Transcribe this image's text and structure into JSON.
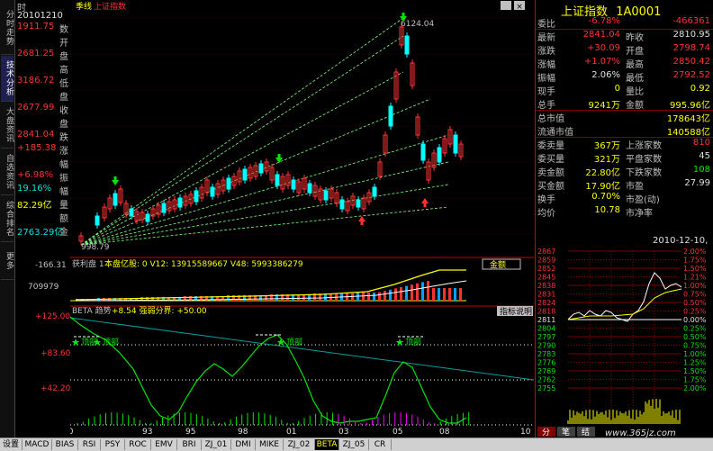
{
  "window": {
    "period_label": "季线",
    "index_label": "上证指数",
    "close_glyph": "×"
  },
  "vtabs": [
    {
      "label": "分时走势",
      "active": false
    },
    {
      "label": "技术分析",
      "active": true
    },
    {
      "label": "大盘资讯",
      "active": false
    },
    {
      "label": "自选资讯",
      "active": false
    },
    {
      "label": "综合排名",
      "active": false
    },
    {
      "label": "更多",
      "active": false
    }
  ],
  "info": {
    "header_time": "时",
    "date": "20101210",
    "rows": [
      {
        "label": "数",
        "value": "1911.75",
        "color": "red"
      },
      {
        "label": "开",
        "value": ""
      },
      {
        "label": "盘",
        "value": "2681.25",
        "color": "red"
      },
      {
        "label": "高",
        "value": ""
      },
      {
        "label": "低",
        "value": "3186.72",
        "color": "red"
      },
      {
        "label": "盘",
        "value": ""
      },
      {
        "label": "收",
        "value": "2677.99",
        "color": "red"
      },
      {
        "label": "盘",
        "value": ""
      },
      {
        "label": "跌",
        "value": "2841.04",
        "color": "red"
      },
      {
        "label": "涨",
        "value": "+185.38",
        "color": "red"
      },
      {
        "label": "幅",
        "value": ""
      },
      {
        "label": "振",
        "value": "+6.98%",
        "color": "red"
      },
      {
        "label": "幅",
        "value": "19.16%",
        "color": "cyan"
      },
      {
        "label": "量",
        "value": "82.29亿",
        "color": "yellow"
      },
      {
        "label": "额",
        "value": ""
      },
      {
        "label": "金",
        "value": "2763.29亿",
        "color": "cyan"
      }
    ]
  },
  "chart": {
    "price_high_label": "6124.04",
    "price_low_label": "998.79",
    "left_axis_top": "2841",
    "vol_panel_title": "获利盘 1",
    "vol_panel_text": "本盘亿股: 0  V12: 13915589667  V48: 5993386279",
    "vol_panel_button": "金额",
    "vol_axis": [
      "-166.31",
      "709979"
    ],
    "beta_title": "BETA 趋势",
    "beta_text": "+8.54  强弱分界: +50.00",
    "beta_button": "指标说明",
    "beta_axis": [
      "+125.00",
      "+83.60",
      "+42.20"
    ],
    "beta_bottom_value": "0.00",
    "markers": [
      "顶部",
      "顶部",
      "顶部",
      "顶部"
    ],
    "x_labels": [
      "90",
      "93",
      "95",
      "98",
      "01",
      "03",
      "05",
      "08",
      "10"
    ]
  },
  "quote": {
    "title": "上证指数",
    "code": "1A0001",
    "rows": [
      {
        "l1": "委比",
        "v1": "-6.78%",
        "c1": "red",
        "l2": "",
        "v2": "-466361",
        "c2": "red"
      },
      {
        "l1": "最新",
        "v1": "2841.04",
        "c1": "red",
        "l2": "昨收",
        "v2": "2810.95",
        "c2": "white"
      },
      {
        "l1": "涨跌",
        "v1": "+30.09",
        "c1": "red",
        "l2": "开盘",
        "v2": "2798.74",
        "c2": "red"
      },
      {
        "l1": "涨幅",
        "v1": "+1.07%",
        "c1": "red",
        "l2": "最高",
        "v2": "2850.42",
        "c2": "red"
      },
      {
        "l1": "振幅",
        "v1": "2.06%",
        "c1": "white",
        "l2": "最低",
        "v2": "2792.52",
        "c2": "red"
      },
      {
        "l1": "现手",
        "v1": "0",
        "c1": "yellow",
        "l2": "量比",
        "v2": "0.92",
        "c2": "yellow"
      },
      {
        "l1": "总手",
        "v1": "9241万",
        "c1": "yellow",
        "l2": "金额",
        "v2": "995.96亿",
        "c2": "yellow"
      },
      {
        "l1": "总市值",
        "v1": "",
        "c1": "white",
        "l2": "",
        "v2": "178643亿",
        "c2": "yellow"
      },
      {
        "l1": "流通市值",
        "v1": "",
        "c1": "white",
        "l2": "",
        "v2": "140588亿",
        "c2": "yellow"
      },
      {
        "l1": "委卖量",
        "v1": "367万",
        "c1": "yellow",
        "l2": "上涨家数",
        "v2": "810",
        "c2": "red"
      },
      {
        "l1": "委买量",
        "v1": "321万",
        "c1": "yellow",
        "l2": "平盘家数",
        "v2": "45",
        "c2": "white"
      },
      {
        "l1": "卖金额",
        "v1": "22.80亿",
        "c1": "yellow",
        "l2": "下跌家数",
        "v2": "108",
        "c2": "green"
      },
      {
        "l1": "买金额",
        "v1": "17.90亿",
        "c1": "yellow",
        "l2": "市盈",
        "v2": "27.99",
        "c2": "white"
      },
      {
        "l1": "换手",
        "v1": "0.70%",
        "c1": "yellow",
        "l2": "市盈(动)",
        "v2": "",
        "c2": "white"
      },
      {
        "l1": "均价",
        "v1": "10.78",
        "c1": "yellow",
        "l2": "市净率",
        "v2": "",
        "c2": "white"
      }
    ],
    "intraday_date": "2010-12-10,五",
    "intraday_left_axis": [
      "2867",
      "2859",
      "2852",
      "2845",
      "2838",
      "2831",
      "2824",
      "2818",
      "2811",
      "2804",
      "2797",
      "2790",
      "2783",
      "2776",
      "2769",
      "2762",
      "2755"
    ],
    "intraday_right_axis": [
      "2.00%",
      "1.75%",
      "1.50%",
      "1.21%",
      "1.00%",
      "0.75%",
      "0.50%",
      "0.25%",
      "0.00%",
      "0.25%",
      "0.50%",
      "0.75%",
      "1.00%",
      "1.25%",
      "1.50%",
      "1.75%",
      "2.00%"
    ],
    "bottom_tabs": [
      "分",
      "笔",
      "结"
    ]
  },
  "bottom_tabs": [
    {
      "label": "设置",
      "active": false
    },
    {
      "label": "MACD",
      "active": false
    },
    {
      "label": "BIAS",
      "active": false
    },
    {
      "label": "RSI",
      "active": false
    },
    {
      "label": "PSY",
      "active": false
    },
    {
      "label": "ROC",
      "active": false
    },
    {
      "label": "EMV",
      "active": false
    },
    {
      "label": "BRI",
      "active": false
    },
    {
      "label": "ZJ_01",
      "active": false
    },
    {
      "label": "DMI",
      "active": false
    },
    {
      "label": "MIKE",
      "active": false
    },
    {
      "label": "ZJ_02",
      "active": false
    },
    {
      "label": "BETA",
      "active": true
    },
    {
      "label": "ZJ_05",
      "active": false
    },
    {
      "label": "CR",
      "active": false
    }
  ],
  "watermark": "www.365jz.com",
  "colors": {
    "up": "#ff3232",
    "down": "#00ffff",
    "grid": "#800000",
    "accent": "#ffff00"
  }
}
